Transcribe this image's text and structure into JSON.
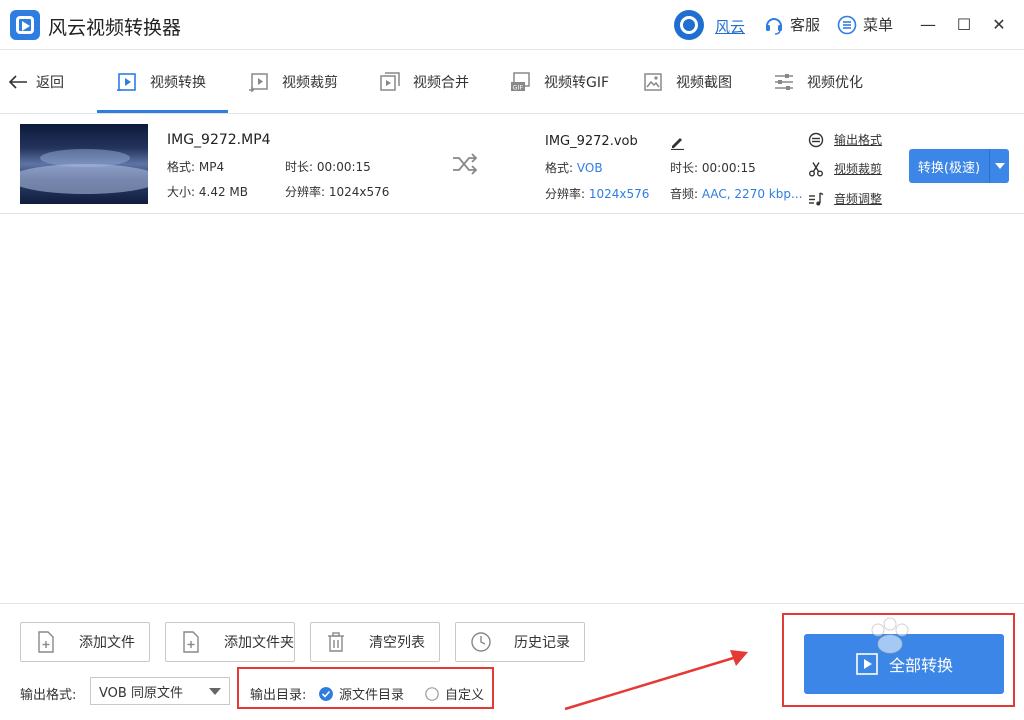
{
  "title_bar": {
    "app_title": "风云视频转换器",
    "user_name": "风云",
    "support_label": "客服",
    "menu_label": "菜单",
    "minimize_glyph": "—",
    "maximize_glyph": "☐",
    "close_glyph": "✕"
  },
  "toolbar": {
    "back_label": "返回",
    "tabs": [
      {
        "label": "视频转换",
        "icon": "video-convert-icon",
        "active": true
      },
      {
        "label": "视频裁剪",
        "icon": "video-crop-icon"
      },
      {
        "label": "视频合并",
        "icon": "video-merge-icon"
      },
      {
        "label": "视频转GIF",
        "icon": "gif-icon"
      },
      {
        "label": "视频截图",
        "icon": "screenshot-icon"
      },
      {
        "label": "视频优化",
        "icon": "optimize-icon"
      }
    ]
  },
  "file": {
    "source": {
      "name": "IMG_9272.MP4",
      "format_label": "格式:",
      "format": "MP4",
      "duration_label": "时长:",
      "duration": "00:00:15",
      "size_label": "大小:",
      "size": "4.42 MB",
      "resolution_label": "分辨率:",
      "resolution": "1024x576"
    },
    "output": {
      "name": "IMG_9272.vob",
      "format_label": "格式:",
      "format": "VOB",
      "duration_label": "时长:",
      "duration": "00:00:15",
      "resolution_label": "分辨率:",
      "resolution": "1024x576",
      "audio_label": "音频:",
      "audio": "AAC, 2270 kbp..."
    },
    "side_links": {
      "output_format": "输出格式",
      "video_crop": "视频裁剪",
      "audio_adjust": "音频调整"
    },
    "convert_button": "转换(极速)"
  },
  "bottom": {
    "buttons": {
      "add_file": "添加文件",
      "add_folder": "添加文件夹",
      "clear_list": "清空列表",
      "history": "历史记录"
    },
    "output_format_label": "输出格式:",
    "output_format_value": "VOB 同原文件",
    "output_dir_label": "输出目录:",
    "dir_option_source": "源文件目录",
    "dir_option_custom": "自定义",
    "dir_selected": "源文件目录",
    "convert_all": "全部转换"
  },
  "colors": {
    "accent": "#3b86e6",
    "highlight": "#e53935"
  }
}
